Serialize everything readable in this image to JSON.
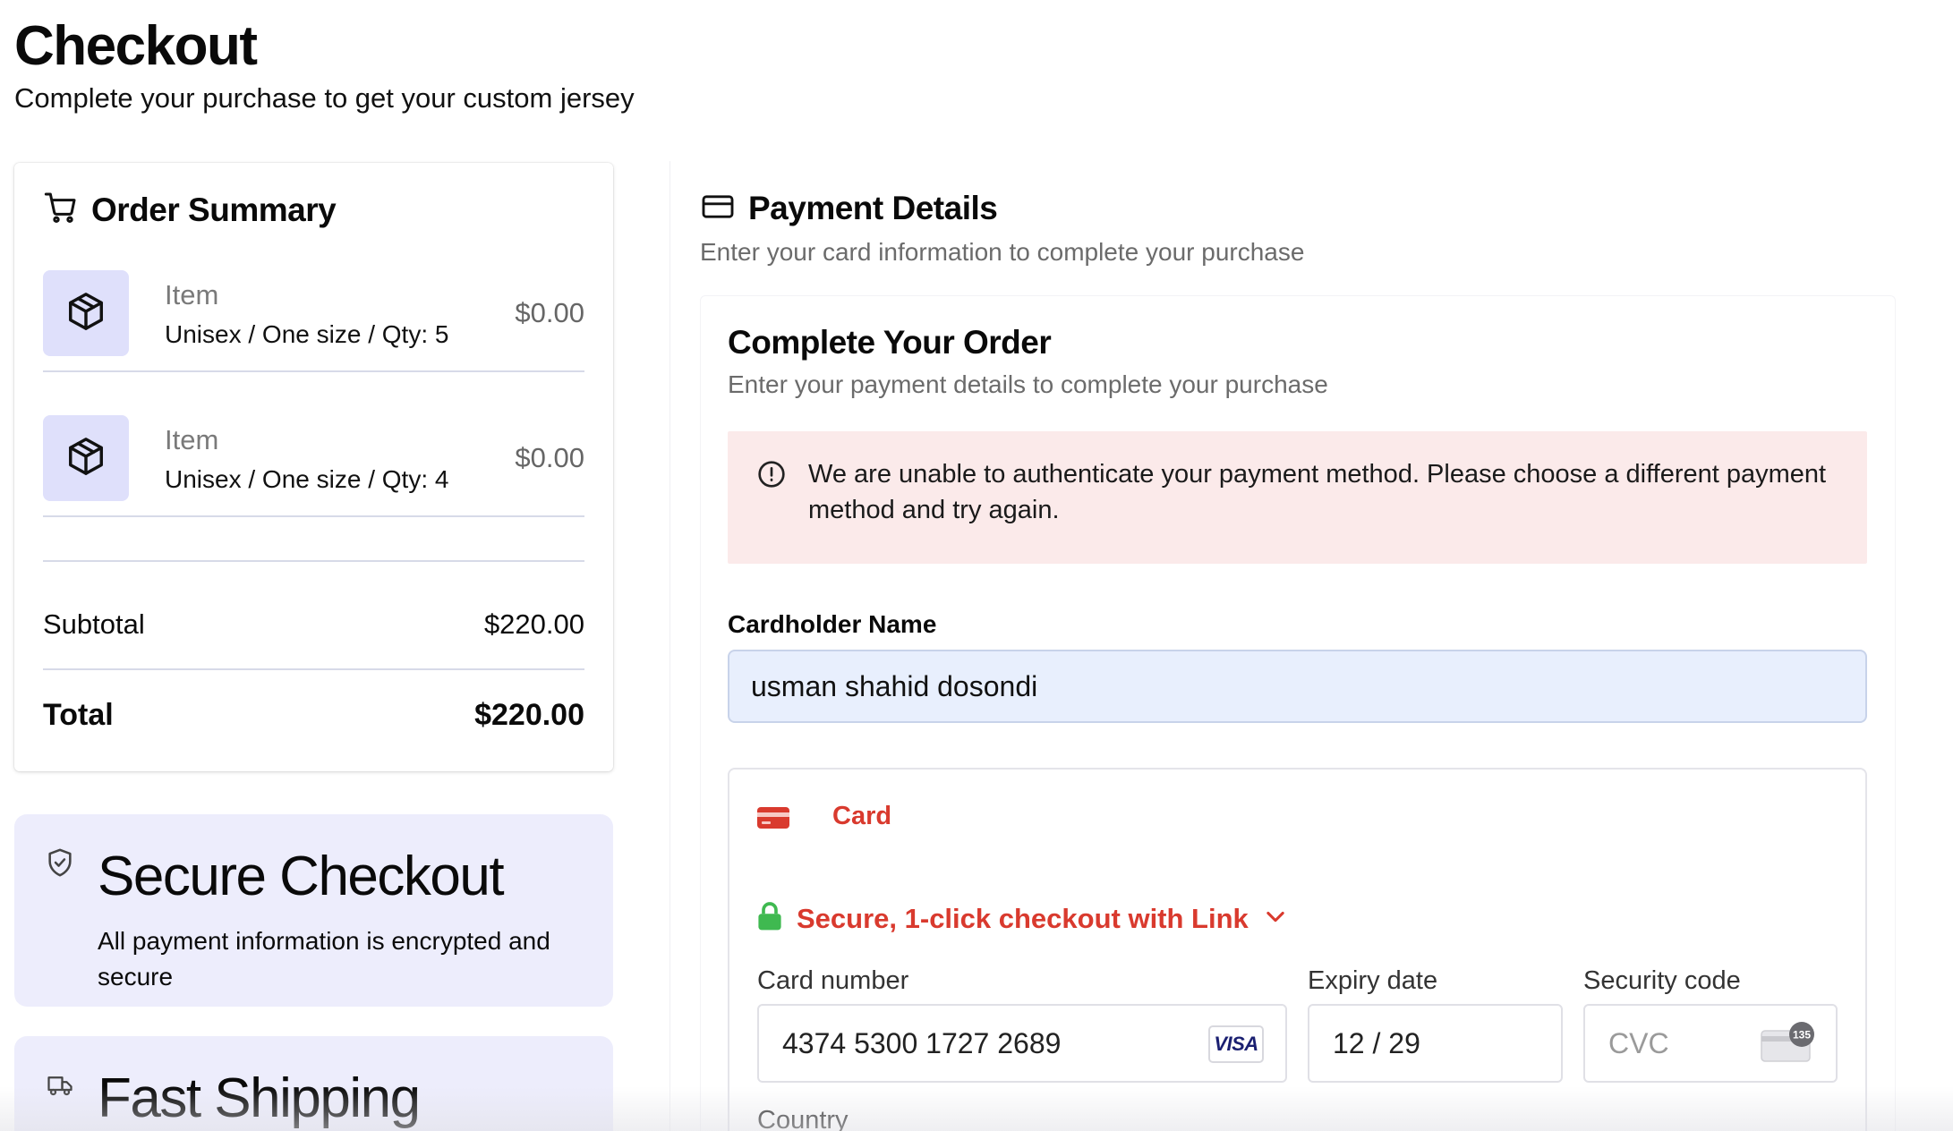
{
  "header": {
    "title": "Checkout",
    "subtitle": "Complete your purchase to get your custom jersey"
  },
  "order_summary": {
    "title": "Order Summary",
    "items": [
      {
        "name": "Item",
        "variant": "Unisex / One size / Qty: 5",
        "price": "$0.00"
      },
      {
        "name": "Item",
        "variant": "Unisex / One size / Qty: 4",
        "price": "$0.00"
      }
    ],
    "subtotal_label": "Subtotal",
    "subtotal_value": "$220.00",
    "total_label": "Total",
    "total_value": "$220.00"
  },
  "secure_card": {
    "title": "Secure Checkout",
    "text": "All payment information is encrypted and secure"
  },
  "shipping_card": {
    "title": "Fast Shipping"
  },
  "payment": {
    "title": "Payment Details",
    "subtitle": "Enter your card information to complete your purchase",
    "order_title": "Complete Your Order",
    "order_subtitle": "Enter your payment details to complete your purchase",
    "error_message": "We are unable to authenticate your payment method. Please choose a different payment method and try again.",
    "cardholder_label": "Cardholder Name",
    "cardholder_value": "usman shahid dosondi",
    "card_tab_label": "Card",
    "link_text": "Secure, 1-click checkout with Link",
    "card_number_label": "Card number",
    "card_number_value": "4374 5300 1727 2689",
    "card_brand": "VISA",
    "expiry_label": "Expiry date",
    "expiry_value": "12 / 29",
    "security_label": "Security code",
    "security_placeholder": "CVC",
    "cvc_badge": "135",
    "country_label": "Country"
  },
  "colors": {
    "accent_red": "#d93a2e",
    "link_green": "#3fb950",
    "error_bg": "#fbeaea",
    "info_card_bg": "#ededfc",
    "thumb_bg": "#dfe0fb"
  }
}
